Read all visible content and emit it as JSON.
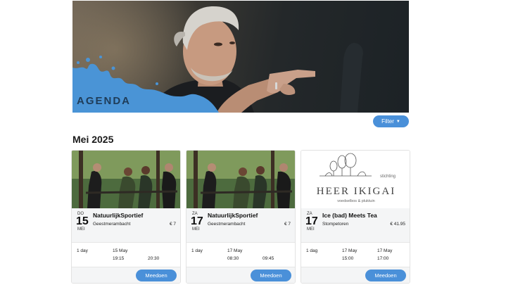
{
  "header": {
    "title": "AGENDA"
  },
  "filter": {
    "label": "Filter",
    "caret_icon": "caret-down-icon"
  },
  "month": {
    "title": "Mei 2025"
  },
  "colors": {
    "accent": "#4a90d9",
    "splash": "#4a94d6",
    "title_dark": "#1f3c58"
  },
  "events": [
    {
      "dow": "DO",
      "day": "15",
      "month": "MEI",
      "title": "NatuurlijkSportief",
      "location": "Geestmerambacht",
      "price": "€ 7",
      "duration": "1 day",
      "start_date": "15 May",
      "end_date": "",
      "start_time": "19:15",
      "end_time": "20:30",
      "button": "Meedoen"
    },
    {
      "dow": "ZA",
      "day": "17",
      "month": "MEI",
      "title": "NatuurlijkSportief",
      "location": "Geestmerambacht",
      "price": "€ 7",
      "duration": "1 day",
      "start_date": "17 May",
      "end_date": "",
      "start_time": "08:30",
      "end_time": "09:45",
      "button": "Meedoen"
    },
    {
      "dow": "ZA",
      "day": "17",
      "month": "MEI",
      "title": "Ice (bad) Meets Tea",
      "location": "Stompetoren",
      "price": "€ 41.95",
      "duration": "1 dag",
      "start_date": "17 May",
      "end_date": "17 May",
      "start_time": "15:00",
      "end_time": "17:00",
      "button": "Meedoen",
      "logo": {
        "line1": "stichting",
        "line2": "HEER IKIGAI",
        "line3": "voedselbos & pluktuin"
      }
    }
  ]
}
